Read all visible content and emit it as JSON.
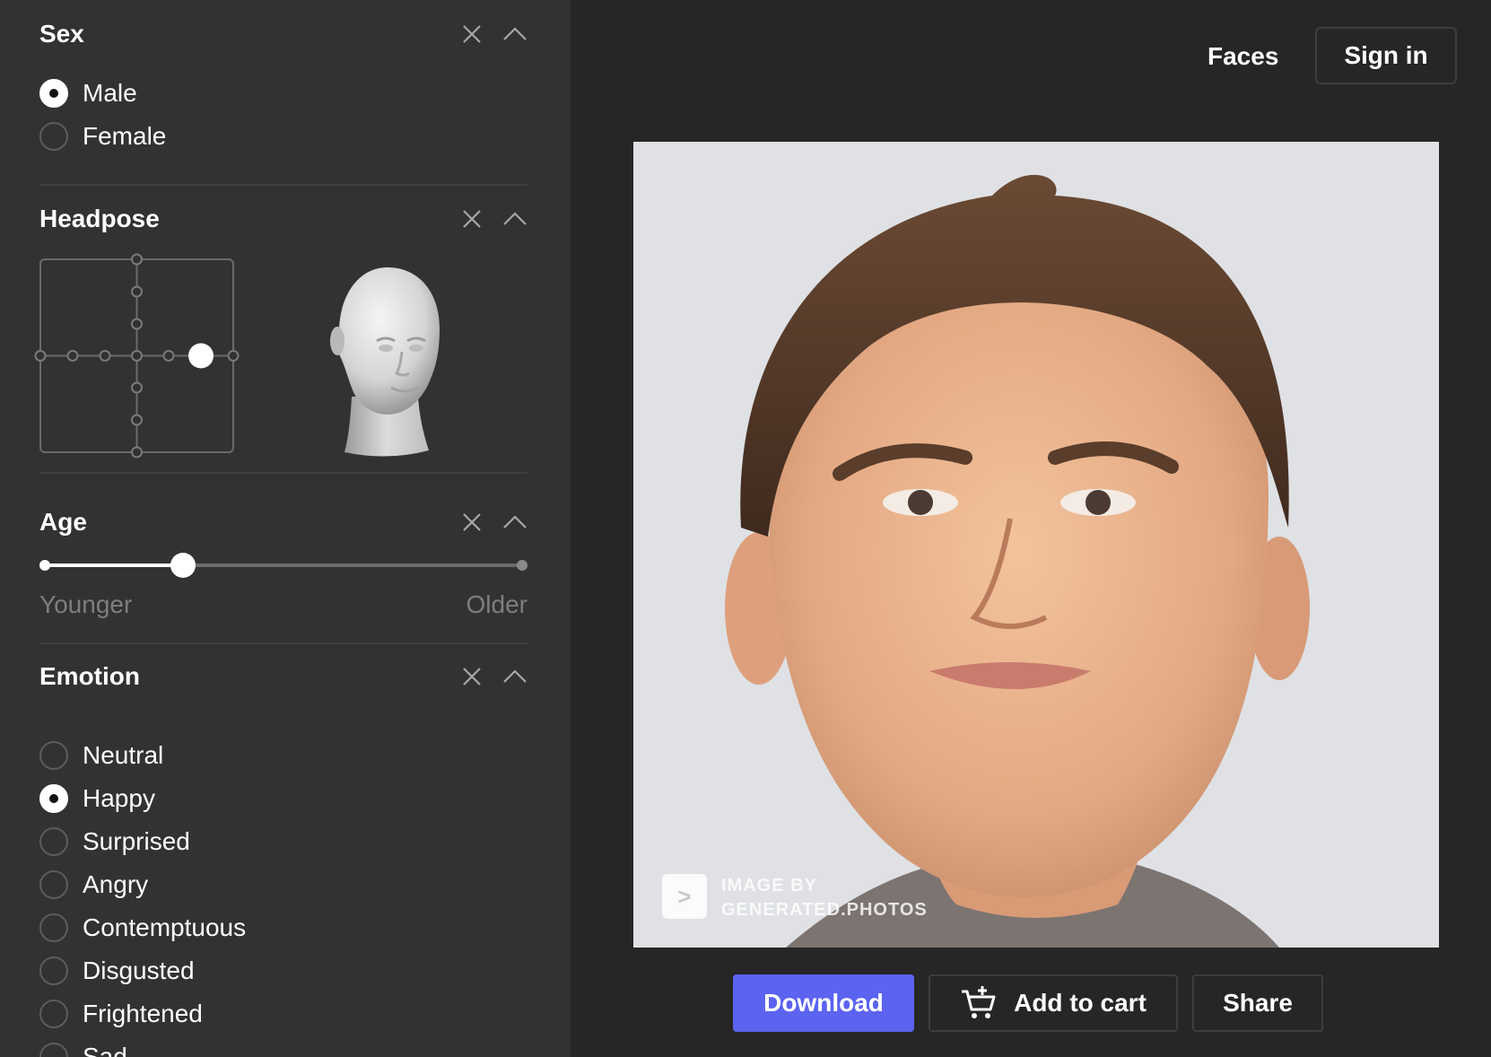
{
  "sidebar": {
    "sex": {
      "title": "Sex",
      "options": [
        {
          "label": "Male",
          "checked": true
        },
        {
          "label": "Female",
          "checked": false
        }
      ]
    },
    "headpose": {
      "title": "Headpose",
      "selected": {
        "yaw_step": 2,
        "pitch_step": 0
      }
    },
    "age": {
      "title": "Age",
      "min_label": "Younger",
      "max_label": "Older",
      "value": 0.29
    },
    "emotion": {
      "title": "Emotion",
      "options": [
        {
          "label": "Neutral",
          "checked": false
        },
        {
          "label": "Happy",
          "checked": true
        },
        {
          "label": "Surprised",
          "checked": false
        },
        {
          "label": "Angry",
          "checked": false
        },
        {
          "label": "Contemptuous",
          "checked": false
        },
        {
          "label": "Disgusted",
          "checked": false
        },
        {
          "label": "Frightened",
          "checked": false
        },
        {
          "label": "Sad",
          "checked": false
        }
      ]
    },
    "icons": {
      "close": "close-icon",
      "collapse": "chevron-up-icon"
    }
  },
  "header": {
    "nav_faces": "Faces",
    "sign_in": "Sign in"
  },
  "photo": {
    "watermark_line1": "IMAGE BY",
    "watermark_line2": "GENERATED.PHOTOS",
    "watermark_logo": ">"
  },
  "actions": {
    "download": "Download",
    "add_to_cart": "Add to cart",
    "share": "Share"
  },
  "colors": {
    "sidebar_bg": "#323232",
    "main_bg": "#262626",
    "accent": "#5b63f0"
  }
}
